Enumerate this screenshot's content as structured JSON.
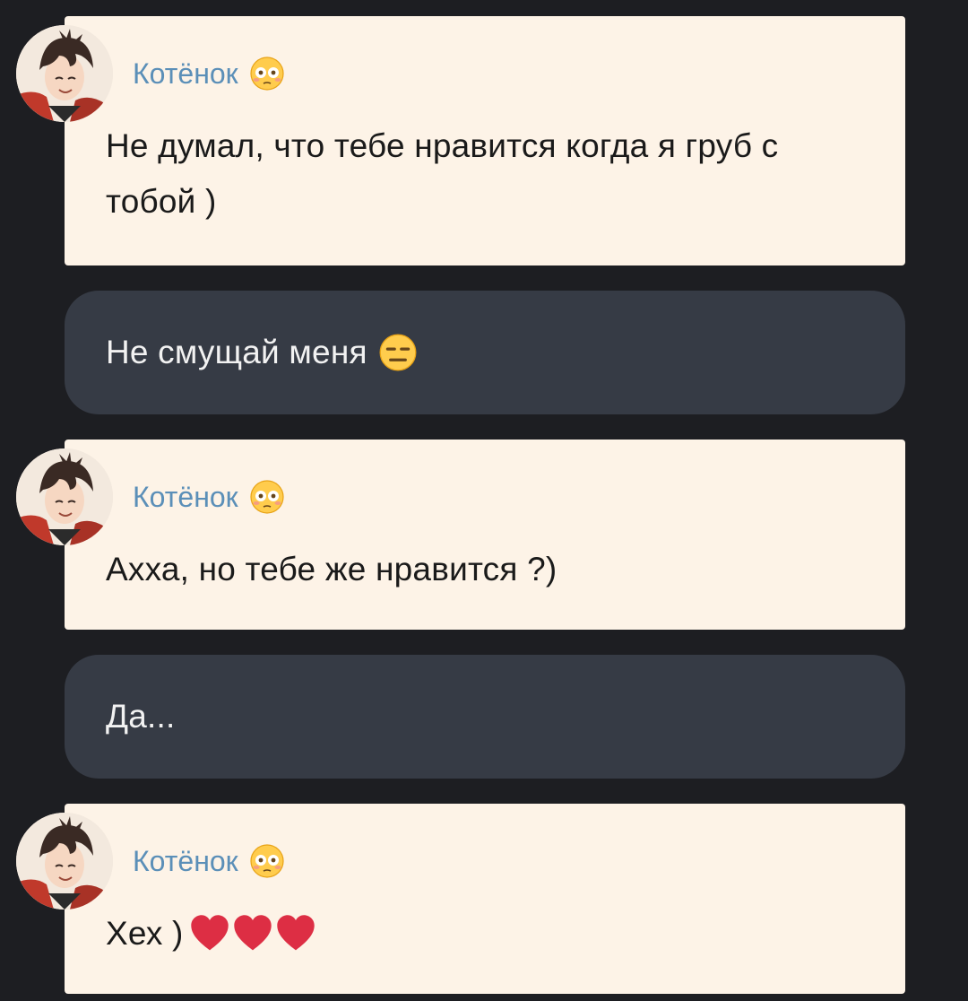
{
  "messages": [
    {
      "type": "incoming",
      "sender": "Котёнок",
      "sender_emoji": "flushed-face-icon",
      "text": "Не думал, что тебе нравится когда я груб с тобой )"
    },
    {
      "type": "outgoing",
      "text": "Не смущай меня",
      "emoji": "expressionless-face-icon"
    },
    {
      "type": "incoming",
      "sender": "Котёнок",
      "sender_emoji": "flushed-face-icon",
      "text": "Ахха, но тебе же нравится ?)"
    },
    {
      "type": "outgoing",
      "text": "Да..."
    },
    {
      "type": "incoming",
      "sender": "Котёнок",
      "sender_emoji": "flushed-face-icon",
      "text": "Хех )",
      "trailing_emojis": [
        "red-heart-icon",
        "red-heart-icon",
        "red-heart-icon"
      ]
    }
  ],
  "colors": {
    "background": "#1d1e22",
    "incoming_bubble": "#fdf3e7",
    "outgoing_bubble": "#363b45",
    "sender_name": "#5b8fb8"
  }
}
